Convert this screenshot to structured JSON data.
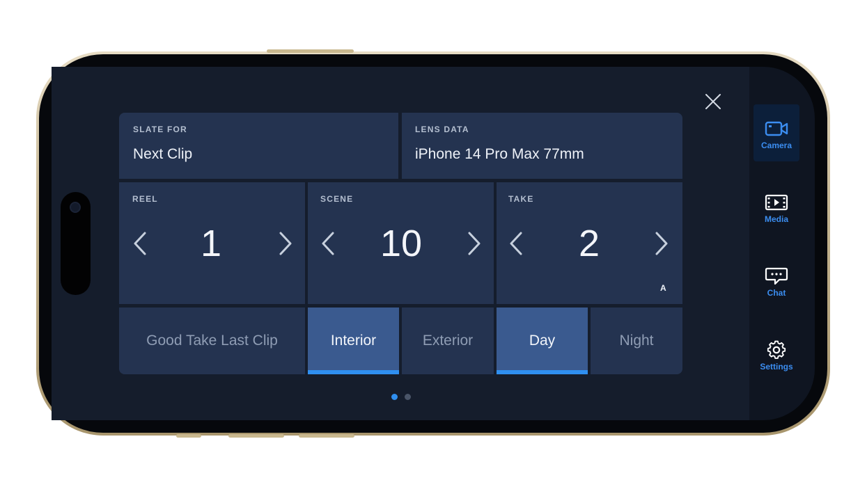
{
  "slate": {
    "slate_for": {
      "label": "SLATE FOR",
      "value": "Next Clip"
    },
    "lens_data": {
      "label": "LENS DATA",
      "value": "iPhone 14 Pro Max 77mm"
    },
    "reel": {
      "label": "REEL",
      "value": "1"
    },
    "scene": {
      "label": "SCENE",
      "value": "10"
    },
    "take": {
      "label": "TAKE",
      "value": "2",
      "suffix": "A"
    },
    "good_take": {
      "label": "Good Take Last Clip",
      "selected": false
    },
    "interior": {
      "label": "Interior",
      "selected": true
    },
    "exterior": {
      "label": "Exterior",
      "selected": false
    },
    "day": {
      "label": "Day",
      "selected": true
    },
    "night": {
      "label": "Night",
      "selected": false
    }
  },
  "pagination": {
    "pages": 2,
    "current": 1
  },
  "sidebar": {
    "items": [
      {
        "label": "Camera",
        "icon": "camera-icon",
        "active": true
      },
      {
        "label": "Media",
        "icon": "film-icon",
        "active": false
      },
      {
        "label": "Chat",
        "icon": "chat-icon",
        "active": false
      },
      {
        "label": "Settings",
        "icon": "gear-icon",
        "active": false
      }
    ]
  },
  "colors": {
    "accent": "#2f8ff0",
    "panel": "#243350",
    "selected": "#3a5a8f",
    "background": "#151d2c"
  }
}
